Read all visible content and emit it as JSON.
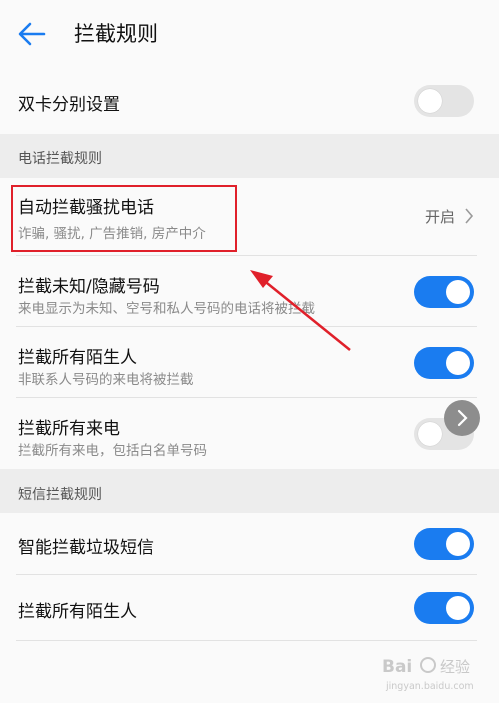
{
  "header": {
    "title": "拦截规则"
  },
  "dual_sim": {
    "label": "双卡分别设置",
    "enabled": false
  },
  "call_section": {
    "title": "电话拦截规则"
  },
  "auto_block": {
    "label": "自动拦截骚扰电话",
    "desc": "诈骗, 骚扰, 广告推销, 房产中介",
    "value": "开启"
  },
  "unknown_hidden": {
    "label": "拦截未知/隐藏号码",
    "desc": "来电显示为未知、空号和私人号码的电话将被拦截",
    "enabled": true
  },
  "strangers_call": {
    "label": "拦截所有陌生人",
    "desc": "非联系人号码的来电将被拦截",
    "enabled": true
  },
  "all_calls": {
    "label": "拦截所有来电",
    "desc": "拦截所有来电，包括白名单号码",
    "enabled": false
  },
  "sms_section": {
    "title": "短信拦截规则"
  },
  "smart_sms": {
    "label": "智能拦截垃圾短信",
    "enabled": true
  },
  "strangers_sms": {
    "label": "拦截所有陌生人",
    "enabled": true
  },
  "colors": {
    "accent": "#1a7cf0",
    "annotation": "#e0202a"
  },
  "watermark": {
    "text": "Baidu 经验",
    "url": "jingyan.baidu.com"
  }
}
